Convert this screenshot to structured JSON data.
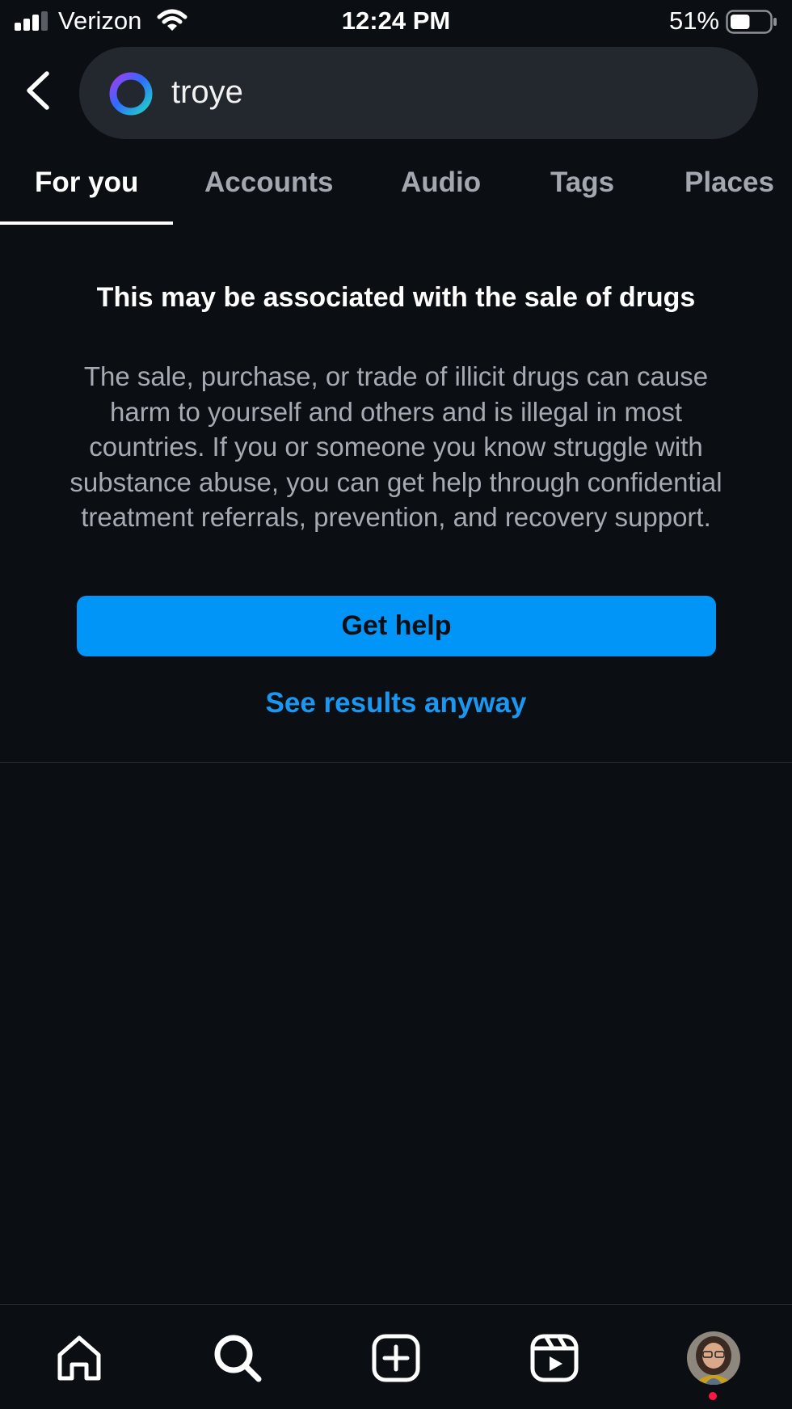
{
  "status_bar": {
    "carrier": "Verizon",
    "time": "12:24 PM",
    "battery_percent": "51%",
    "battery_level": 0.51,
    "signal_icon": "signal-bars-icon",
    "wifi_icon": "wifi-icon",
    "battery_icon": "battery-icon"
  },
  "search": {
    "back_icon": "chevron-left-icon",
    "ring_icon": "meta-ai-ring-icon",
    "query": "troye"
  },
  "tabs": [
    {
      "label": "For you",
      "active": true
    },
    {
      "label": "Accounts",
      "active": false
    },
    {
      "label": "Audio",
      "active": false
    },
    {
      "label": "Tags",
      "active": false
    },
    {
      "label": "Places",
      "active": false
    }
  ],
  "warning": {
    "title": "This may be associated with the sale of drugs",
    "body": "The sale, purchase, or trade of illicit drugs can cause harm to yourself and others and is illegal in most countries. If you or someone you know struggle with substance abuse, you can get help through confidential treatment referrals, prevention, and recovery support.",
    "get_help_label": "Get help",
    "see_results_label": "See results anyway"
  },
  "bottom_nav": {
    "items": [
      "home-icon",
      "search-icon",
      "create-post-icon",
      "reels-icon",
      "profile-avatar"
    ],
    "notification_dot": true
  },
  "colors": {
    "background": "#0b0e13",
    "accent": "#0095f6",
    "link": "#1a97f0",
    "notification": "#ff1744"
  }
}
